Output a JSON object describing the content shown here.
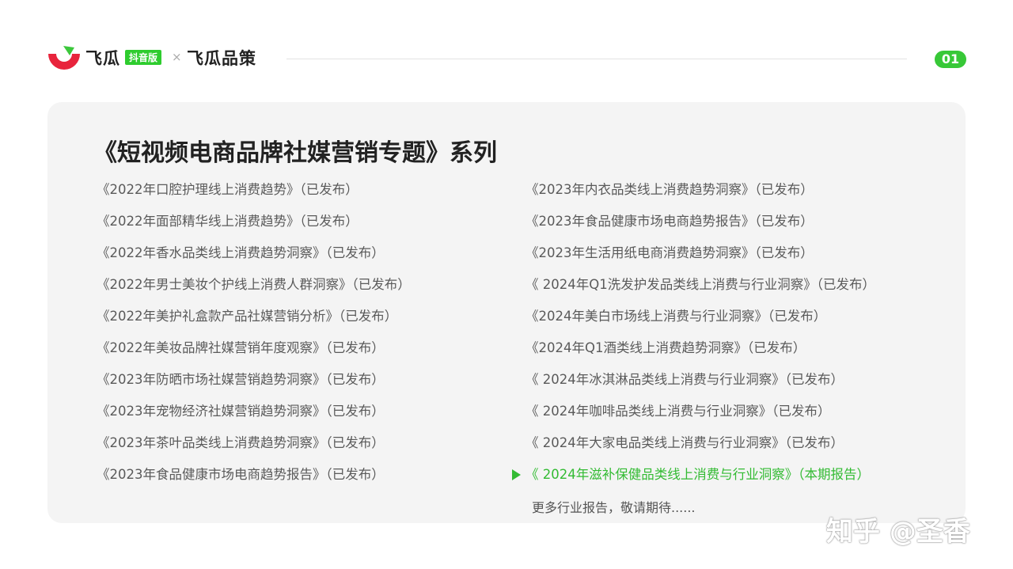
{
  "header": {
    "brand_name": "飞瓜",
    "brand_tag": "抖音版",
    "separator": "×",
    "partner_name": "飞瓜品策",
    "page_number": "01",
    "accent_color": "#37c837"
  },
  "title": "《短视频电商品牌社媒营销专题》系列",
  "left_items": [
    "《2022年口腔护理线上消费趋势》（已发布）",
    "《2022年面部精华线上消费趋势》（已发布）",
    "《2022年香水品类线上消费趋势洞察》（已发布）",
    "《2022年男士美妆个护线上消费人群洞察》（已发布）",
    "《2022年美护礼盒款产品社媒营销分析》（已发布）",
    "《2022年美妆品牌社媒营销年度观察》（已发布）",
    "《2023年防晒市场社媒营销趋势洞察》（已发布）",
    "《2023年宠物经济社媒营销趋势洞察》（已发布）",
    "《2023年茶叶品类线上消费趋势洞察》（已发布）",
    "《2023年食品健康市场电商趋势报告》（已发布）"
  ],
  "right_items": [
    "《2023年内衣品类线上消费趋势洞察》（已发布）",
    "《2023年食品健康市场电商趋势报告》（已发布）",
    "《2023年生活用纸电商消费趋势洞察》（已发布）",
    "《 2024年Q1洗发护发品类线上消费与行业洞察》（已发布）",
    "《2024年美白市场线上消费与行业洞察》（已发布）",
    "《2024年Q1酒类线上消费趋势洞察》（已发布）",
    "《 2024年冰淇淋品类线上消费与行业洞察》（已发布）",
    "《 2024年咖啡品类线上消费与行业洞察》（已发布）",
    "《 2024年大家电品类线上消费与行业洞察》（已发布）"
  ],
  "current_item": "《 2024年滋补保健品类线上消费与行业洞察》（本期报告）",
  "more_text": "更多行业报告，敬请期待......",
  "watermark": "知乎 @圣香"
}
